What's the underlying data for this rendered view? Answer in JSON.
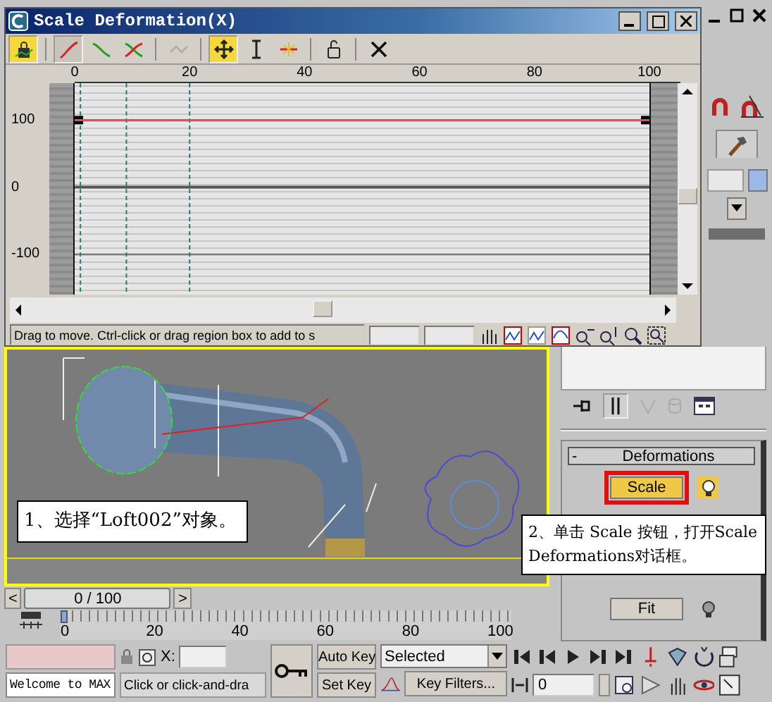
{
  "dialog": {
    "title": "Scale Deformation(X)",
    "tools": [
      {
        "selected": true,
        "lit": true,
        "disabled": false
      },
      {
        "selected": true,
        "lit": false,
        "disabled": false
      },
      {
        "selected": false,
        "lit": false,
        "disabled": false
      },
      {
        "selected": false,
        "lit": false,
        "disabled": false
      },
      {
        "selected": false,
        "lit": false,
        "disabled": true
      },
      {
        "selected": true,
        "lit": true,
        "disabled": false
      },
      {
        "selected": false,
        "lit": false,
        "disabled": false
      },
      {
        "selected": false,
        "lit": false,
        "disabled": false
      },
      {
        "selected": false,
        "lit": false,
        "disabled": false
      },
      {
        "selected": false,
        "lit": false,
        "disabled": false
      }
    ],
    "chart_data": {
      "type": "line",
      "x": [
        0,
        100
      ],
      "series": [
        {
          "color": "#e05050",
          "values": [
            100,
            100
          ],
          "marker": "square"
        }
      ],
      "ref_lines": [
        {
          "axis": "y",
          "value": 100
        },
        {
          "axis": "y",
          "value": 0
        },
        {
          "axis": "y",
          "value": -100
        },
        {
          "axis": "x",
          "value": 1
        },
        {
          "axis": "x",
          "value": 9
        },
        {
          "axis": "x",
          "value": 20
        }
      ],
      "xlim": [
        0,
        100
      ],
      "ylim": [
        -160,
        155
      ],
      "grid": true,
      "xticks": [
        0,
        20,
        40,
        60,
        80,
        100
      ],
      "yticks": [
        100,
        0,
        -100
      ]
    },
    "status": "Drag to move. Ctrl-click or drag region box to add to s"
  },
  "viewport": {
    "active": true
  },
  "callouts": [
    {
      "text": "1、选择“Loft002”对象。"
    },
    {
      "text": "2、单击 Scale 按钮，打开Scale Deformations对话框。"
    }
  ],
  "rollout": {
    "toggle": "-",
    "title": "Deformations",
    "buttons": [
      {
        "label": "Scale",
        "on": true,
        "highlighted": true
      },
      {
        "label": "Fit",
        "on": false,
        "highlighted": false
      }
    ]
  },
  "time_slider": {
    "prev": "<",
    "position": "0 / 100",
    "next": ">"
  },
  "track_bar": {
    "ticks": [
      "0",
      "20",
      "40",
      "60",
      "80",
      "100"
    ]
  },
  "status_bar": {
    "welcome": "Welcome to MAX",
    "coord_label": "X:",
    "prompt": "Click or click-and-dra",
    "auto_key": "Auto Key",
    "set_key": "Set Key",
    "key_mode": "Selected",
    "key_filters": "Key Filters...",
    "frame": "0"
  }
}
